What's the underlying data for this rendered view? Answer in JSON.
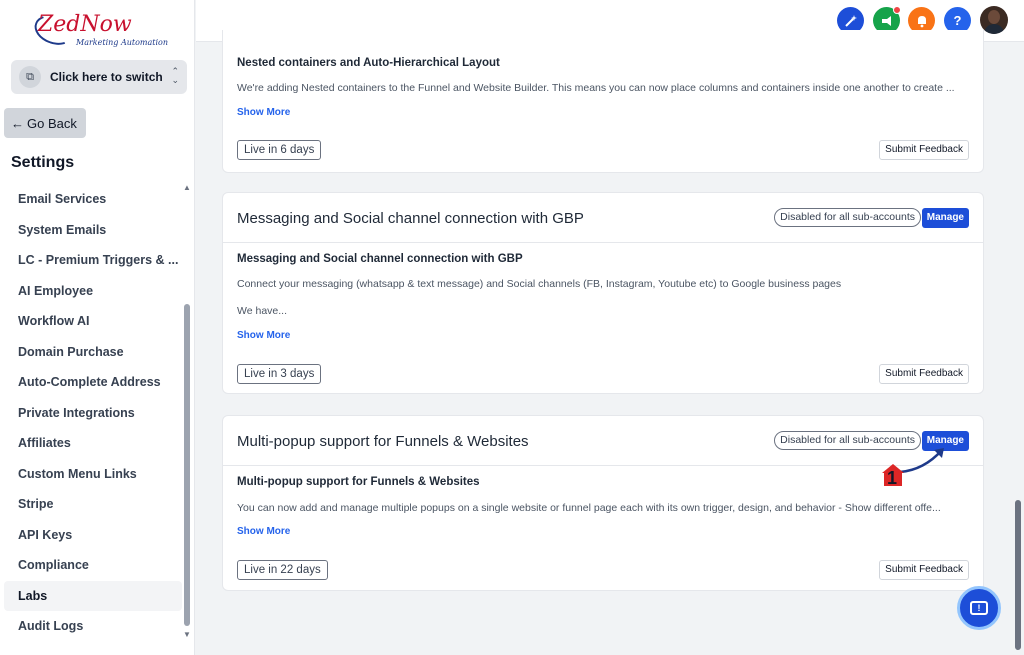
{
  "brand": {
    "name": "ZedNow",
    "tagline": "Marketing Automation"
  },
  "switcher": {
    "label": "Click here to switch"
  },
  "nav": {
    "go_back": "Go Back",
    "settings_title": "Settings"
  },
  "sidebar": {
    "items": [
      {
        "label": "Email Services"
      },
      {
        "label": "System Emails"
      },
      {
        "label": "LC - Premium Triggers & ..."
      },
      {
        "label": "AI Employee"
      },
      {
        "label": "Workflow AI"
      },
      {
        "label": "Domain Purchase"
      },
      {
        "label": "Auto-Complete Address"
      },
      {
        "label": "Private Integrations"
      },
      {
        "label": "Affiliates"
      },
      {
        "label": "Custom Menu Links"
      },
      {
        "label": "Stripe"
      },
      {
        "label": "API Keys"
      },
      {
        "label": "Compliance"
      },
      {
        "label": "Labs"
      },
      {
        "label": "Audit Logs"
      }
    ],
    "active": "Labs"
  },
  "header": {
    "icons": [
      {
        "name": "magic-icon",
        "color": "#1d4ed8"
      },
      {
        "name": "megaphone-icon",
        "color": "#16a34a"
      },
      {
        "name": "bell-icon",
        "color": "#f97316"
      },
      {
        "name": "help-icon",
        "color": "#2563eb"
      }
    ]
  },
  "cards": [
    {
      "subtitle": "Nested containers and Auto-Hierarchical Layout",
      "description": "We're adding Nested containers to the Funnel and Website Builder. This means you can now place columns and containers inside one another to create ...",
      "show_more": "Show More",
      "live": "Live in 6 days",
      "feedback": "Submit Feedback"
    },
    {
      "title": "Messaging and Social channel connection with GBP",
      "status": "Disabled for all sub-accounts",
      "manage": "Manage",
      "subtitle": "Messaging and Social channel connection with GBP",
      "description": "Connect your messaging (whatsapp & text message) and Social channels (FB, Instagram, Youtube etc) to Google business pages",
      "description2": "We have...",
      "show_more": "Show More",
      "live": "Live in 3 days",
      "feedback": "Submit Feedback"
    },
    {
      "title": "Multi-popup support for Funnels & Websites",
      "status": "Disabled for all sub-accounts",
      "manage": "Manage",
      "subtitle": "Multi-popup support for Funnels & Websites",
      "description": "You can now add and manage multiple popups on a single website or funnel page each with its own trigger, design, and behavior - Show different offe...",
      "show_more": "Show More",
      "live": "Live in 22 days",
      "feedback": "Submit Feedback"
    }
  ],
  "annotation": {
    "step": "1"
  },
  "colors": {
    "accent": "#1d4ed8",
    "link": "#2563eb",
    "brand_red": "#c8102e"
  }
}
